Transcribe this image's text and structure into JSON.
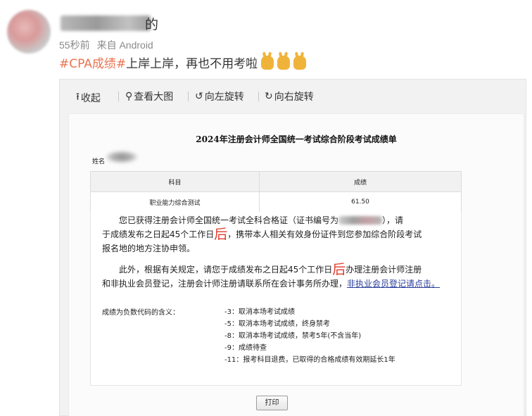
{
  "post": {
    "username_tail": "的",
    "time": "55秒前",
    "source": "来自 Android",
    "hashtag": "#CPA成绩#",
    "text": "上岸上岸，再也不用考啦"
  },
  "toolbar": {
    "collapse": "收起",
    "view_large": "查看大图",
    "rotate_left": "向左旋转",
    "rotate_right": "向右旋转"
  },
  "document": {
    "title": "2024年注册会计师全国统一考试综合阶段考试成绩单",
    "name_label": "姓名",
    "table": {
      "headers": [
        "科目",
        "成绩"
      ],
      "rows": [
        [
          "职业能力综合测试",
          "61.50"
        ]
      ]
    },
    "para1_a": "您已获得注册会计师全国统一考试全科合格证（证书编号为",
    "para1_b": "），请",
    "para1_c": "于成绩发布之日起45个工作日",
    "para1_hou": "后",
    "para1_d": "，携带本人相关有效身份证件到您参加综合阶段考试",
    "para1_e": "报名地的地方注协申领。",
    "para2_a": "此外，根据有关规定，请您于成绩发布之日起45个工作日",
    "para2_hou": "后",
    "para2_b": "办理注册会计师注册",
    "para2_c": "和非执业会员登记，注册会计师注册请联系所在会计事务所办理，",
    "para2_link": "非执业会员登记请点击。",
    "codes_label": "成绩为负数代码的含义：",
    "codes": [
      "-3：取消本场考试成绩",
      "-5：取消本场考试成绩，终身禁考",
      "-8：取消本场考试成绩，禁考5年(不含当年)",
      "-9：成绩待查",
      "-11：报考科目退费，已取得的合格成绩有效期延长1年"
    ],
    "print_button": "打印"
  }
}
